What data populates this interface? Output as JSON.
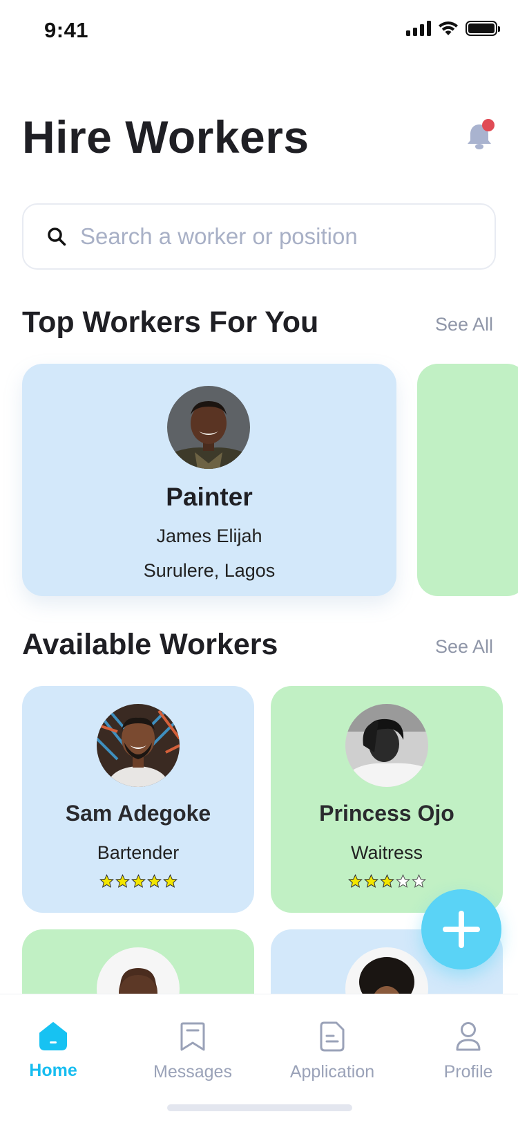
{
  "status_bar": {
    "time": "9:41"
  },
  "header": {
    "title": "Hire Workers"
  },
  "search": {
    "placeholder": "Search a worker or position",
    "value": ""
  },
  "top_workers": {
    "title": "Top Workers For You",
    "see_all": "See All",
    "featured": {
      "role": "Painter",
      "name": "James Elijah",
      "location": "Surulere, Lagos"
    }
  },
  "available_workers": {
    "title": "Available Workers",
    "see_all": "See All",
    "items": [
      {
        "name": "Sam Adegoke",
        "job": "Bartender",
        "rating": 5,
        "bg": "blue"
      },
      {
        "name": "Princess Ojo",
        "job": "Waitress",
        "rating": 3,
        "bg": "green"
      },
      {
        "name": "",
        "job": "",
        "bg": "green"
      },
      {
        "name": "",
        "job": "",
        "bg": "blue"
      }
    ]
  },
  "nav": {
    "items": [
      {
        "label": "Home",
        "icon": "home-icon",
        "active": true
      },
      {
        "label": "Messages",
        "icon": "bookmark-message-icon",
        "active": false
      },
      {
        "label": "Application",
        "icon": "document-icon",
        "active": false
      },
      {
        "label": "Profile",
        "icon": "user-icon",
        "active": false
      }
    ]
  },
  "colors": {
    "accent": "#17bdf0",
    "fab": "#5ad3f6",
    "card_blue": "#d3e8fa",
    "card_green": "#c1f0c4",
    "notification_dot": "#e04b55"
  }
}
